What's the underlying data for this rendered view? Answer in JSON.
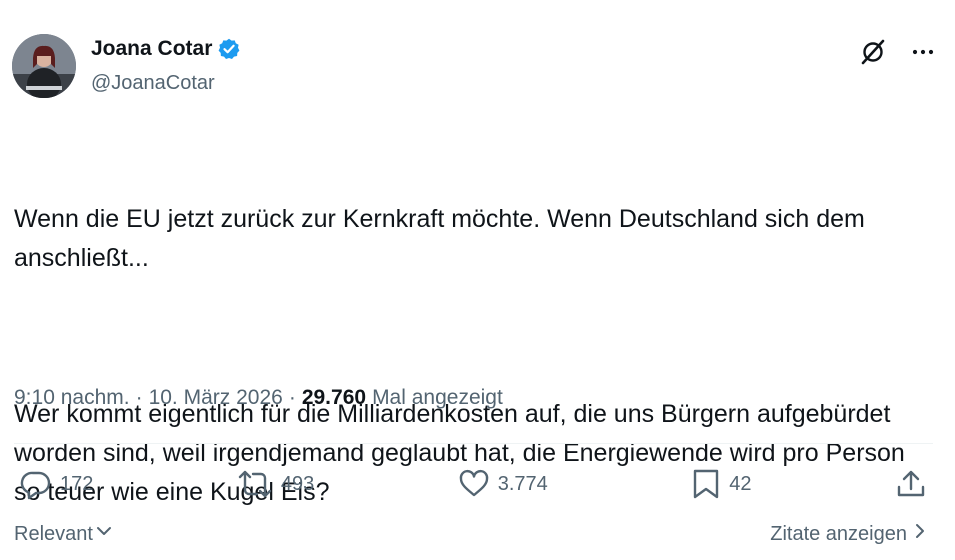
{
  "author": {
    "name": "Joana Cotar",
    "handle": "@JoanaCotar"
  },
  "tweet": {
    "paragraph1": "Wenn die EU jetzt zurück zur Kernkraft möchte. Wenn Deutschland sich dem anschließt...",
    "paragraph2": "Wer kommt eigentlich für die Milliardenkosten auf, die uns Bürgern aufgebürdet worden sind, weil irgendjemand geglaubt hat, die Energiewende wird pro Person so teuer wie eine Kugel Eis?"
  },
  "meta": {
    "time": "9:10 nachm.",
    "sep1": "·",
    "date": "10. März 2026",
    "sep2": "·",
    "views": "29.760",
    "views_label": "Mal angezeigt"
  },
  "actions": {
    "replies": "172",
    "reposts": "493",
    "likes": "3.774",
    "bookmarks": "42"
  },
  "footer": {
    "sort_label": "Relevant",
    "quotes_label": "Zitate anzeigen"
  },
  "colors": {
    "text": "#0f1419",
    "secondary": "#536471",
    "verified": "#1d9bf0",
    "divider": "#eff3f4"
  },
  "icons": {
    "top": [
      "grok-icon",
      "more-icon"
    ],
    "actions": [
      "reply-icon",
      "repost-icon",
      "like-icon",
      "bookmark-icon",
      "share-icon"
    ]
  }
}
